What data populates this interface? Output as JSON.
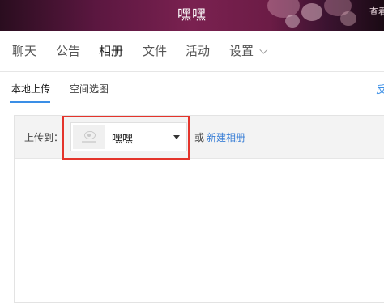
{
  "header": {
    "title": "嘿嘿",
    "corner_text": "查看"
  },
  "nav": {
    "tabs": [
      {
        "label": "聊天"
      },
      {
        "label": "公告"
      },
      {
        "label": "相册"
      },
      {
        "label": "文件"
      },
      {
        "label": "活动"
      },
      {
        "label": "设置"
      }
    ],
    "active": "相册"
  },
  "subtabs": {
    "items": [
      {
        "label": "本地上传"
      },
      {
        "label": "空间选图"
      }
    ],
    "active": "本地上传",
    "right_text": "反"
  },
  "upload": {
    "label": "上传到：",
    "selected_album": "嘿嘿",
    "or_text": "或",
    "new_album_link": "新建相册"
  },
  "colors": {
    "accent": "#3a8ee6",
    "highlight_box": "#e4342b",
    "link": "#3a7fd6"
  }
}
